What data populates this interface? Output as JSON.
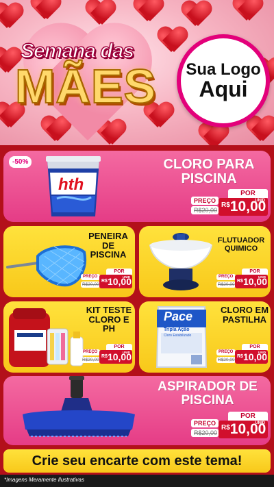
{
  "header": {
    "title_line1": "Semana das",
    "title_line2": "MÃES",
    "logo_line1": "Sua Logo",
    "logo_line2": "Aqui"
  },
  "colors": {
    "brand_pink": "#e53c86",
    "brand_yellow": "#f8c81a",
    "brand_red": "#d10f2c",
    "background": "#b3101a"
  },
  "products": [
    {
      "name": "CLORO PARA PISCINA",
      "discount": "-50%",
      "por": "POR",
      "preco": "PREÇO",
      "old_price": "R$20,00",
      "currency": "R$",
      "new_price": "10,00",
      "unit": "UNID",
      "icon": "chlorine-bucket-icon",
      "brand_text": "hth"
    },
    {
      "name": "PENEIRA DE PISCINA",
      "por": "POR",
      "preco": "PREÇO",
      "old_price": "R$20,00",
      "currency": "R$",
      "new_price": "10,00",
      "unit": "UNID",
      "icon": "pool-net-icon"
    },
    {
      "name": "FLUTUADOR QUIMICO",
      "por": "POR",
      "preco": "PREÇO",
      "old_price": "R$20,00",
      "currency": "R$",
      "new_price": "10,00",
      "unit": "UNID",
      "icon": "chemical-floater-icon"
    },
    {
      "name": "KIT TESTE CLORO E PH",
      "por": "POR",
      "preco": "PREÇO",
      "old_price": "R$20,00",
      "currency": "R$",
      "new_price": "10,00",
      "unit": "UNID",
      "icon": "test-kit-icon"
    },
    {
      "name": "CLORO EM PASTILHA",
      "por": "POR",
      "preco": "PREÇO",
      "old_price": "R$20,00",
      "currency": "R$",
      "new_price": "10,00",
      "unit": "UNID",
      "icon": "chlorine-tablet-bag-icon",
      "brand_text": "Pace",
      "package_line1": "Tripla Ação",
      "package_line2": "Cloro Estabilizado"
    },
    {
      "name": "ASPIRADOR DE PISCINA",
      "por": "POR",
      "preco": "PREÇO",
      "old_price": "R$20,00",
      "currency": "R$",
      "new_price": "10,00",
      "unit": "UNID",
      "icon": "pool-vacuum-icon"
    }
  ],
  "cta": "Crie seu encarte com este tema!",
  "footer": "*Imagens Meramente Ilustrativas"
}
